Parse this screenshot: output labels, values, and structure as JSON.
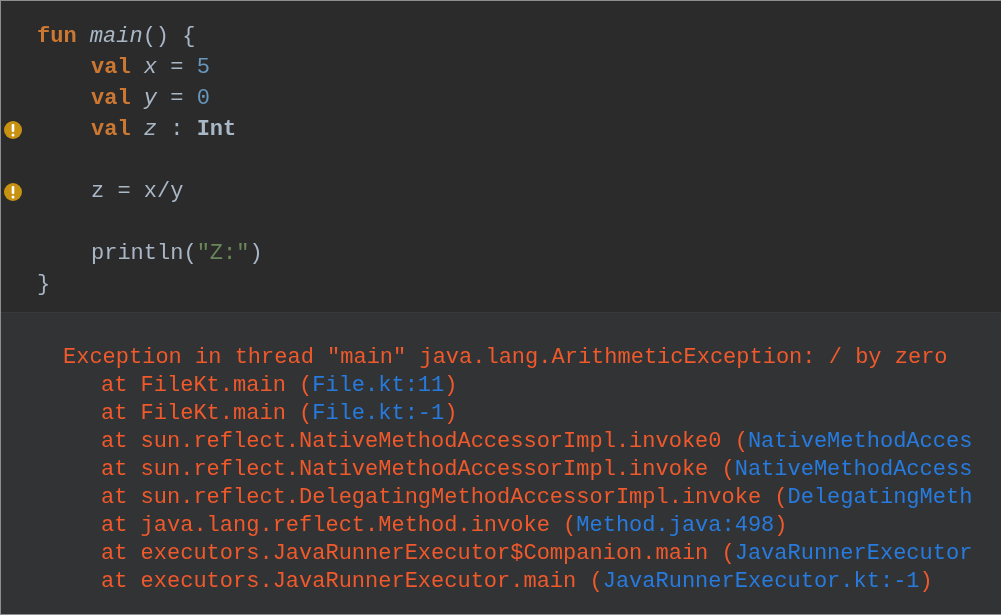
{
  "editor": {
    "lines": [
      {
        "kind": "code",
        "warning": false,
        "tokens": [
          {
            "text": "fun",
            "kind": "keyword"
          },
          {
            "text": " main",
            "kind": "function"
          },
          {
            "text": "() {",
            "kind": "plain"
          }
        ],
        "children": [
          {
            "kind": "code",
            "warning": false,
            "tokens": [
              {
                "text": "val",
                "kind": "keyword"
              },
              {
                "text": " x",
                "kind": "variable"
              },
              {
                "text": " = ",
                "kind": "plain"
              },
              {
                "text": "5",
                "kind": "number"
              }
            ]
          },
          {
            "kind": "code",
            "warning": false,
            "tokens": [
              {
                "text": "val",
                "kind": "keyword"
              },
              {
                "text": " y",
                "kind": "variable"
              },
              {
                "text": " = ",
                "kind": "plain"
              },
              {
                "text": "0",
                "kind": "number"
              }
            ]
          },
          {
            "kind": "code",
            "warning": true,
            "tokens": [
              {
                "text": "val",
                "kind": "keyword"
              },
              {
                "text": " z",
                "kind": "variable"
              },
              {
                "text": " : ",
                "kind": "plain"
              },
              {
                "text": "Int",
                "kind": "type"
              }
            ]
          },
          {
            "kind": "blank",
            "warning": false
          },
          {
            "kind": "code",
            "warning": true,
            "tokens": [
              {
                "text": "z = x/y",
                "kind": "plain"
              }
            ]
          },
          {
            "kind": "blank",
            "warning": false
          },
          {
            "kind": "code",
            "warning": false,
            "tokens": [
              {
                "text": "println(",
                "kind": "plain"
              },
              {
                "text": "\"Z:\"",
                "kind": "string"
              },
              {
                "text": ")",
                "kind": "plain"
              }
            ]
          }
        ]
      },
      {
        "kind": "code",
        "warning": false,
        "tokens": [
          {
            "text": "}",
            "kind": "plain"
          }
        ]
      }
    ]
  },
  "console": {
    "exception": "Exception in thread \"main\" java.lang.ArithmeticException: / by zero",
    "frames": [
      {
        "text": "at FileKt.main (",
        "location": "File.kt:11",
        "close": ")"
      },
      {
        "text": "at FileKt.main (",
        "location": "File.kt:-1",
        "close": ")"
      },
      {
        "text": "at sun.reflect.NativeMethodAccessorImpl.invoke0 (",
        "location": "NativeMethodAcces"
      },
      {
        "text": "at sun.reflect.NativeMethodAccessorImpl.invoke (",
        "location": "NativeMethodAccess"
      },
      {
        "text": "at sun.reflect.DelegatingMethodAccessorImpl.invoke (",
        "location": "DelegatingMeth"
      },
      {
        "text": "at java.lang.reflect.Method.invoke (",
        "location": "Method.java:498",
        "close": ")"
      },
      {
        "text": "at executors.JavaRunnerExecutor$Companion.main (",
        "location": "JavaRunnerExecutor"
      },
      {
        "text": "at executors.JavaRunnerExecutor.main (",
        "location": "JavaRunnerExecutor.kt:-1",
        "close": ")"
      }
    ]
  }
}
